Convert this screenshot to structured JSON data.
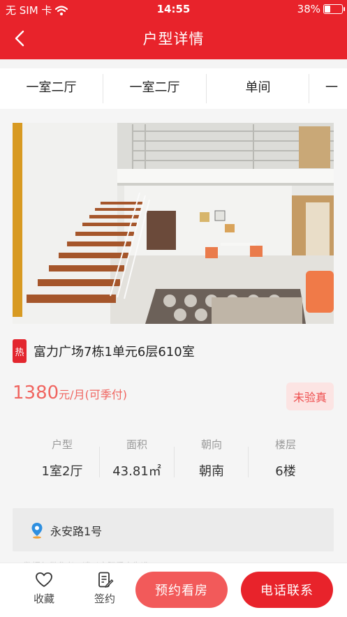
{
  "status": {
    "carrier": "无 SIM 卡",
    "time": "14:55",
    "battery": "38%",
    "battery_level": 0.38
  },
  "header": {
    "title": "户型详情"
  },
  "tabs": [
    "一室二厅",
    "一室二厅",
    "单间",
    "一"
  ],
  "listing": {
    "hot_badge": "热",
    "address": "富力广场7栋1单元6层610室",
    "price_number": "1380",
    "price_unit": "元/月(可季付)",
    "verify": "未验真",
    "info": [
      {
        "label": "户型",
        "value": "1室2厅"
      },
      {
        "label": "面积",
        "value": "43.81㎡"
      },
      {
        "label": "朝向",
        "value": "朝南"
      },
      {
        "label": "楼层",
        "value": "6楼"
      }
    ],
    "location": "永安路1号",
    "note": "* 数据仅供参考，请以实际看房为准"
  },
  "bottom": {
    "favorite": "收藏",
    "sign": "签约",
    "book": "预约看房",
    "call": "电话联系"
  },
  "colors": {
    "brand": "#e8232b",
    "price": "#f06560",
    "book_button": "#f25a5a"
  },
  "icons": {
    "back": "chevron-left-icon",
    "wifi": "wifi-icon",
    "battery": "battery-icon",
    "location": "location-pin-icon",
    "favorite": "heart-icon",
    "sign": "document-edit-icon"
  }
}
